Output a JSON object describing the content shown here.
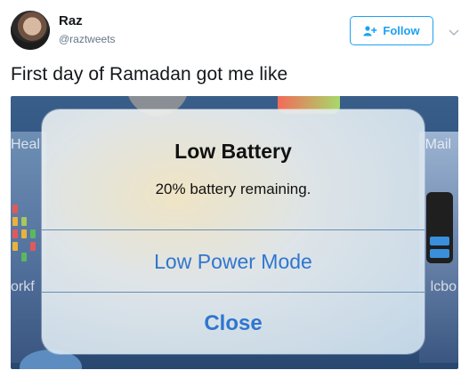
{
  "tweet": {
    "user": {
      "name": "Raz",
      "handle": "@raztweets"
    },
    "follow_label": "Follow",
    "text": "First day of Ramadan got me like"
  },
  "media": {
    "background_labels": {
      "left_top": "Heal",
      "right_top": "Mail",
      "left_mid": "orkf",
      "right_mid": "lcbo"
    },
    "alert": {
      "title": "Low Battery",
      "message": "20% battery remaining.",
      "actions": [
        {
          "label": "Low Power Mode"
        },
        {
          "label": "Close"
        }
      ]
    }
  },
  "colors": {
    "twitter_blue": "#1da1f2",
    "ios_link_blue": "#2f76cf",
    "text_dark": "#14171a",
    "handle_gray": "#657786"
  },
  "icons": {
    "follow": "add-user-icon",
    "menu": "chevron-down-icon"
  }
}
